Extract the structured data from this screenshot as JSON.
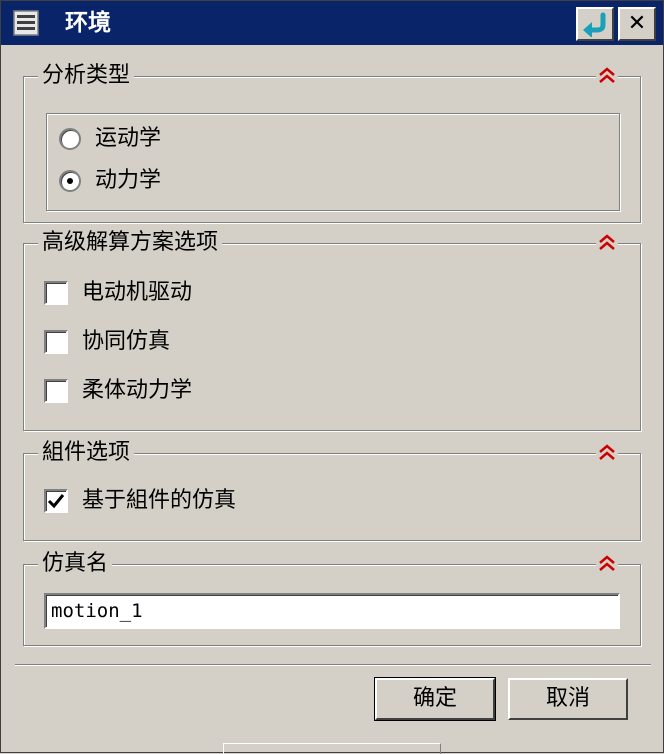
{
  "window": {
    "title": "环境",
    "icon": "dialog-list-icon",
    "reset_icon": "reset-arrow-icon",
    "close_label": "✕"
  },
  "analysis_type": {
    "legend": "分析类型",
    "options": [
      {
        "label": "运动学",
        "selected": false
      },
      {
        "label": "动力学",
        "selected": true
      }
    ]
  },
  "advanced_solver": {
    "legend": "高级解算方案选项",
    "options": [
      {
        "label": "电动机驱动",
        "checked": false
      },
      {
        "label": "协同仿真",
        "checked": false
      },
      {
        "label": "柔体动力学",
        "checked": false
      }
    ]
  },
  "component_options": {
    "legend": "組件选项",
    "options": [
      {
        "label": "基于組件的仿真",
        "checked": true
      }
    ]
  },
  "simulation_name": {
    "legend": "仿真名",
    "value": "motion_1"
  },
  "buttons": {
    "ok": "确定",
    "cancel": "取消"
  },
  "colors": {
    "titlebar": "#0a246a",
    "collapse_chevron": "#cc0000",
    "dialog_bg": "#d4d0c8"
  }
}
